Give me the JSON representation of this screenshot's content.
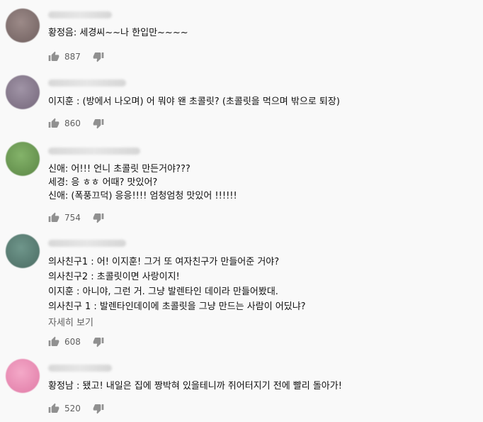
{
  "comments": [
    {
      "avatar_color": "#8a7b7b",
      "lines": [
        "황정음: 세경씨~~나 한입만~~~~"
      ],
      "likes": "887"
    },
    {
      "avatar_color": "#8c7f92",
      "lines": [
        "이지훈 : (방에서 나오며) 어 뭐야 왠 초콜릿? (초콜릿을 먹으며 밖으로 퇴장)"
      ],
      "likes": "860"
    },
    {
      "avatar_color": "#6f9a58",
      "lines": [
        "신애: 어!!! 언니 초콜릿 만든거야???",
        "세경: 응 ㅎㅎ 어때? 맛있어?",
        "신애: (폭풍끄덕) 응응!!!! 엄청엄청 맛있어 !!!!!!"
      ],
      "likes": "754"
    },
    {
      "avatar_color": "#5b7e75",
      "lines": [
        "의사친구1 : 어! 이지훈! 그거 또 여자친구가 만들어준 거야?",
        "의사친구2 : 초콜릿이면 사랑이지!",
        "이지훈 : 아니야, 그런 거. 그냥 발렌타인 데이라 만들어봤대.",
        "의사친구 1 : 발렌타인데이에 초콜릿을 그냥 만드는 사람이 어딨냐?"
      ],
      "read_more": "자세히 보기",
      "likes": "608"
    },
    {
      "avatar_color": "#e98fb6",
      "lines": [
        "황정남 : 됐고! 내일은 집에 짱박혀 있을테니까 쥐어터지기 전에 빨리 돌아가!"
      ],
      "likes": "520"
    }
  ]
}
